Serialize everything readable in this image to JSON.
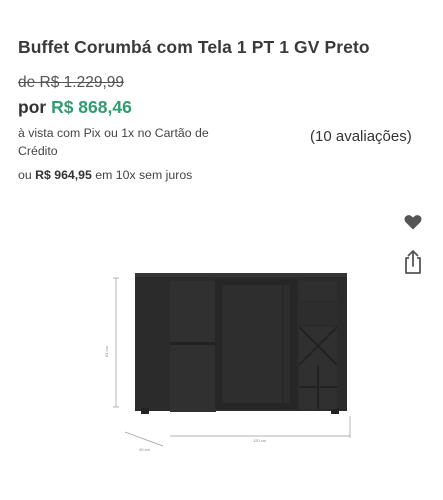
{
  "product": {
    "title": "Buffet Corumbá com Tela 1 PT 1 GV Preto",
    "old_price": "de R$ 1.229,99",
    "price_prefix": "por ",
    "price": "R$ 868,46",
    "payment_note": "à vista com Pix ou 1x no Cartão de Crédito",
    "reviews": "(10 avaliações)",
    "installments_prefix": "ou ",
    "installments_total": "R$ 964,95",
    "installments_suffix": " em 10x sem juros"
  },
  "image": {
    "dim_height": "81 cm",
    "dim_depth": "40 cm",
    "dim_width": "120 cm"
  },
  "icons": {
    "favorite": "heart-icon",
    "share": "share-icon"
  },
  "colors": {
    "price": "#2e9d6f",
    "furniture": "#2b2b2b",
    "icon": "#555555"
  }
}
